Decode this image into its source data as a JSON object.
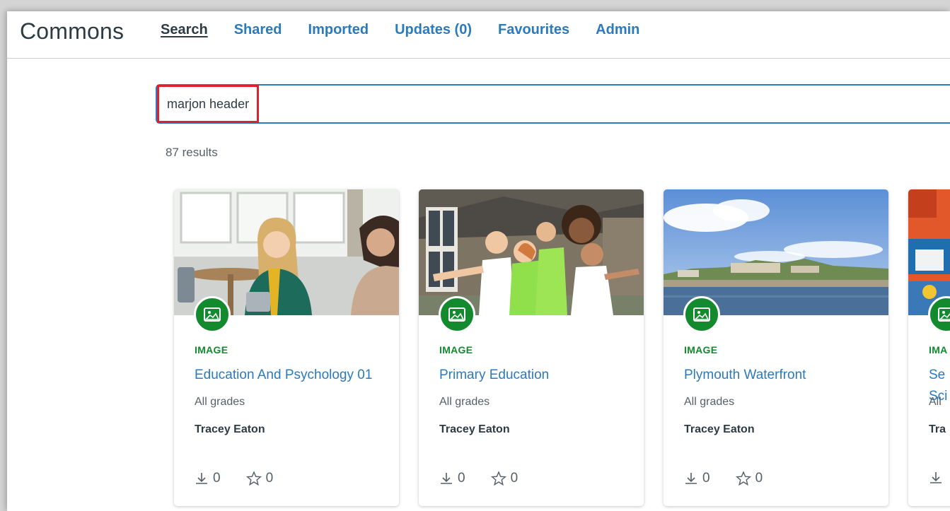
{
  "app": {
    "title": "Commons"
  },
  "nav": {
    "items": [
      {
        "label": "Search"
      },
      {
        "label": "Shared"
      },
      {
        "label": "Imported"
      },
      {
        "label": "Updates (0)"
      },
      {
        "label": "Favourites"
      },
      {
        "label": "Admin"
      }
    ],
    "active": "Search"
  },
  "search": {
    "value": "marjon header",
    "placeholder": ""
  },
  "results": {
    "count_text": "87 results",
    "cards": [
      {
        "type": "IMAGE",
        "title": "Education And Psychology 01",
        "grades": "All grades",
        "author": "Tracey Eaton",
        "downloads": "0",
        "favourites": "0"
      },
      {
        "type": "IMAGE",
        "title": "Primary Education",
        "grades": "All grades",
        "author": "Tracey Eaton",
        "downloads": "0",
        "favourites": "0"
      },
      {
        "type": "IMAGE",
        "title": "Plymouth Waterfront",
        "grades": "All grades",
        "author": "Tracey Eaton",
        "downloads": "0",
        "favourites": "0"
      },
      {
        "type": "IMA",
        "title": "Se Sci",
        "grades": "All",
        "author": "Tra",
        "downloads": "",
        "favourites": ""
      }
    ]
  },
  "colors": {
    "accent": "#2b7abc",
    "image_badge": "#138a2e",
    "highlight": "#e0212b",
    "text": "#2d3b45"
  },
  "icons": {
    "type_badge": "image-icon",
    "download": "download-icon",
    "favourite": "star-icon"
  }
}
